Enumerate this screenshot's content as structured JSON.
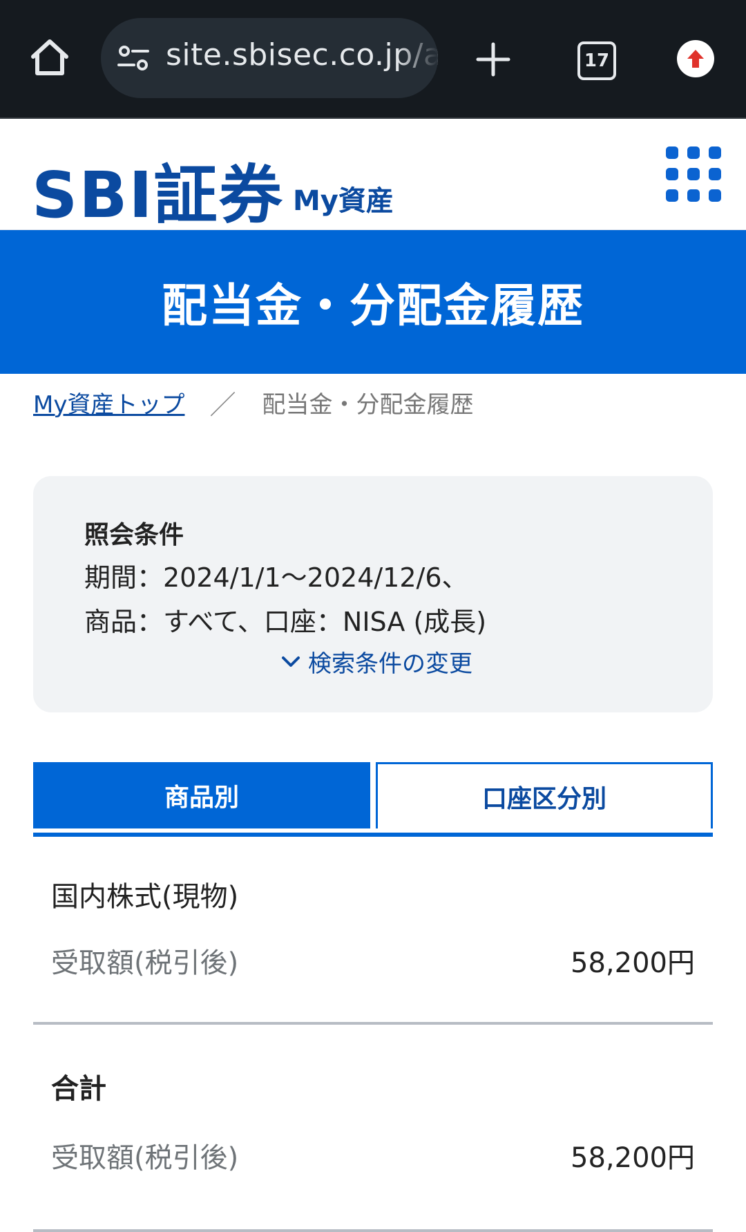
{
  "browser": {
    "url": "site.sbisec.co.jp/a",
    "tab_count": "17"
  },
  "header": {
    "logo": "SBI証券",
    "subtitle": "My資産"
  },
  "page": {
    "title": "配当金・分配金履歴"
  },
  "breadcrumb": {
    "home": "My資産トップ",
    "separator": "／",
    "current": "配当金・分配金履歴"
  },
  "conditions": {
    "title": "照会条件",
    "line1": "期間：2024/1/1～2024/12/6、",
    "line2": "商品：すべて、口座：NISA (成長)",
    "change_label": "検索条件の変更"
  },
  "tabs": [
    {
      "label": "商品別",
      "active": true
    },
    {
      "label": "口座区分別",
      "active": false
    }
  ],
  "results": {
    "category": {
      "name": "国内株式(現物)",
      "amount_label": "受取額(税引後)",
      "amount_value": "58,200円"
    },
    "total": {
      "title": "合計",
      "amount_label": "受取額(税引後)",
      "amount_value": "58,200円"
    }
  },
  "colors": {
    "brand_blue": "#0066d6",
    "logo_blue": "#0b4aa0",
    "chrome_bg": "#151a1f"
  }
}
